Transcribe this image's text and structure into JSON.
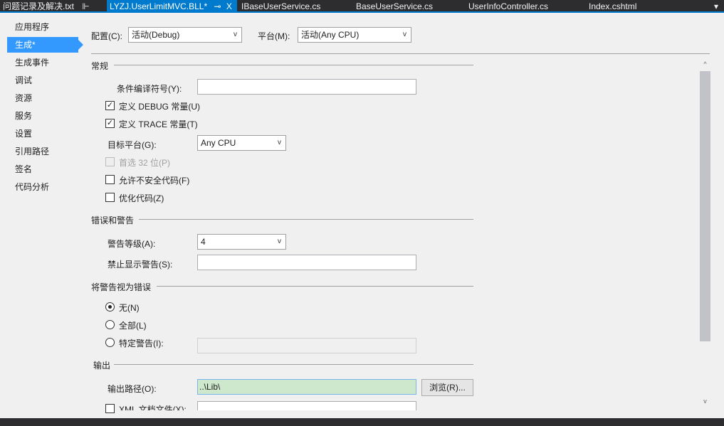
{
  "tabs": [
    {
      "label": "问题记录及解决.txt",
      "pin": "⊩",
      "active": false
    },
    {
      "label": "LYZJ.UserLimitMVC.BLL*",
      "pin": "⊸",
      "close": "X",
      "active": true
    },
    {
      "label": "IBaseUserService.cs",
      "active": false
    },
    {
      "label": "BaseUserService.cs",
      "active": false
    },
    {
      "label": "UserInfoController.cs",
      "active": false
    },
    {
      "label": "Index.cshtml",
      "active": false
    }
  ],
  "tab_overflow": "▾",
  "nav": [
    "应用程序",
    "生成*",
    "生成事件",
    "调试",
    "资源",
    "服务",
    "设置",
    "引用路径",
    "签名",
    "代码分析"
  ],
  "config": {
    "label": "配置(C):",
    "value": "活动(Debug)",
    "platform_label": "平台(M):",
    "platform_value": "活动(Any CPU)"
  },
  "general": {
    "title": "常规",
    "symbols_label": "条件编译符号(Y):",
    "symbols_value": "",
    "debug_label": "定义 DEBUG 常量(U)",
    "debug_checked": true,
    "trace_label": "定义 TRACE 常量(T)",
    "trace_checked": true,
    "target_label": "目标平台(G):",
    "target_value": "Any CPU",
    "prefer32_label": "首选 32 位(P)",
    "unsafe_label": "允许不安全代码(F)",
    "optimize_label": "优化代码(Z)"
  },
  "errors": {
    "title": "错误和警告",
    "level_label": "警告等级(A):",
    "level_value": "4",
    "suppress_label": "禁止显示警告(S):",
    "suppress_value": ""
  },
  "treat": {
    "title": "将警告视为错误",
    "none": "无(N)",
    "all": "全部(L)",
    "specific": "特定警告(I):",
    "selected": "none"
  },
  "output": {
    "title": "输出",
    "path_label": "输出路径(O):",
    "path_value": "..\\Lib\\",
    "browse": "浏览(R)...",
    "xml_label": "XML 文档文件(X):"
  },
  "chevron": "v"
}
